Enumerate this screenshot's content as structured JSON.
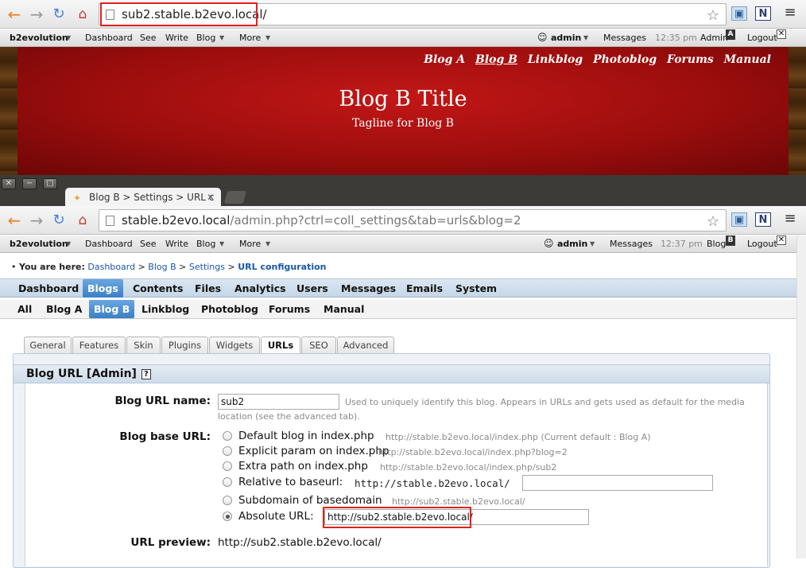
{
  "top_window": {
    "browser": {
      "url": "sub2.stable.b2evo.local/"
    },
    "evobar": {
      "brand": "b2evolution",
      "menu": [
        "Dashboard",
        "See",
        "Write",
        "Blog",
        "More"
      ],
      "user": "admin",
      "messages": "Messages",
      "time": "12:35 pm",
      "admin_label": "Admin",
      "logout": "Logout"
    },
    "banner": {
      "nav": [
        "Blog A",
        "Blog B",
        "Linkblog",
        "Photoblog",
        "Forums",
        "Manual"
      ],
      "active_nav": "Blog B",
      "title": "Blog B Title",
      "tagline": "Tagline for Blog B"
    }
  },
  "bottom_window": {
    "tab_title": "Blog B > Settings > URL c",
    "browser": {
      "url_host": "stable.b2evo.local",
      "url_path": "/admin.php?ctrl=coll_settings&tab=urls&blog=2"
    },
    "evobar": {
      "brand": "b2evolution",
      "menu": [
        "Dashboard",
        "See",
        "Write",
        "Blog",
        "More"
      ],
      "user": "admin",
      "messages": "Messages",
      "time": "12:37 pm",
      "blog_label": "Blog",
      "logout": "Logout"
    },
    "breadcrumb": {
      "prefix": "You are here:",
      "items": [
        "Dashboard",
        "Blog B",
        "Settings"
      ],
      "current": "URL configuration",
      "sep": ">"
    },
    "main_menu": [
      "Dashboard",
      "Blogs",
      "Contents",
      "Files",
      "Analytics",
      "Users",
      "Messages",
      "Emails",
      "System"
    ],
    "main_menu_selected": "Blogs",
    "blog_menu": [
      "All",
      "Blog A",
      "Blog B",
      "Linkblog",
      "Photoblog",
      "Forums",
      "Manual"
    ],
    "blog_menu_selected": "Blog B",
    "settings_tabs": [
      "General",
      "Features",
      "Skin",
      "Plugins",
      "Widgets",
      "URLs",
      "SEO",
      "Advanced"
    ],
    "settings_tab_selected": "URLs",
    "panel": {
      "title": "Blog URL [Admin]",
      "help_icon": "?",
      "url_name_label": "Blog URL name:",
      "url_name_value": "sub2",
      "url_name_note_1": "Used to uniquely identify this blog. Appears in URLs and gets used as default for the media",
      "url_name_note_2": "location (see the advanced tab).",
      "base_url_label": "Blog base URL:",
      "options": [
        {
          "label": "Default blog in index.php",
          "note": "http://stable.b2evo.local/index.php (Current default : Blog A)",
          "selected": false
        },
        {
          "label": "Explicit param on index.php",
          "note": "http://stable.b2evo.local/index.php?blog=2",
          "selected": false
        },
        {
          "label": "Extra path on index.php",
          "note": "http://stable.b2evo.local/index.php/sub2",
          "selected": false
        },
        {
          "label": "Relative to baseurl:",
          "note": "http://stable.b2evo.local/",
          "selected": false
        },
        {
          "label": "Subdomain of basedomain",
          "note": "http://sub2.stable.b2evo.local/",
          "selected": false
        },
        {
          "label": "Absolute URL:",
          "note": "http://sub2.stable.b2evo.local/",
          "selected": true
        }
      ],
      "preview_label": "URL preview:",
      "preview_value": "http://sub2.stable.b2evo.local/"
    }
  },
  "colors": {
    "highlight": "#e3201b",
    "banner_red": "#b01212",
    "menu_selected": "#3b7fc7",
    "link": "#1a56a6"
  }
}
